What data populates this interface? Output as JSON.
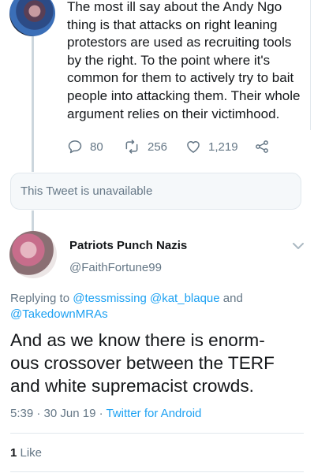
{
  "parent_tweet": {
    "text": "The most ill say about the Andy Ngo thing is that attacks on right leaning protestors are used as recruiting tools by the right. To the point where it's common for them to actively try to bait people into attacking them. Their whole argument relies on their victimhood.",
    "replies": "80",
    "retweets": "256",
    "likes": "1,219"
  },
  "unavailable": {
    "text": "This Tweet is unavailable"
  },
  "main_tweet": {
    "display_name": "Patriots Punch Nazis",
    "handle": "@FaithFortune99",
    "replying_prefix": "Replying to ",
    "reply_user_1": "@tessmissing",
    "reply_user_2": "@kat_blaque",
    "reply_and": " and",
    "reply_user_3": "@TakedownMRAs",
    "text_line1": "And as we know there is enorm-",
    "text_line2": "ous crossover between the TERF",
    "text_line3": "and white supremacist crowds.",
    "time": "5:39",
    "sep1": " · ",
    "date": "30 Jun 19",
    "sep2": " · ",
    "source": "Twitter for Android",
    "like_count": "1",
    "like_label": " Like"
  },
  "colors": {
    "accent": "#1da1f2",
    "muted": "#657786",
    "text": "#14171a"
  },
  "icons": [
    "reply-icon",
    "retweet-icon",
    "like-icon",
    "share-icon",
    "chevron-down-icon"
  ]
}
